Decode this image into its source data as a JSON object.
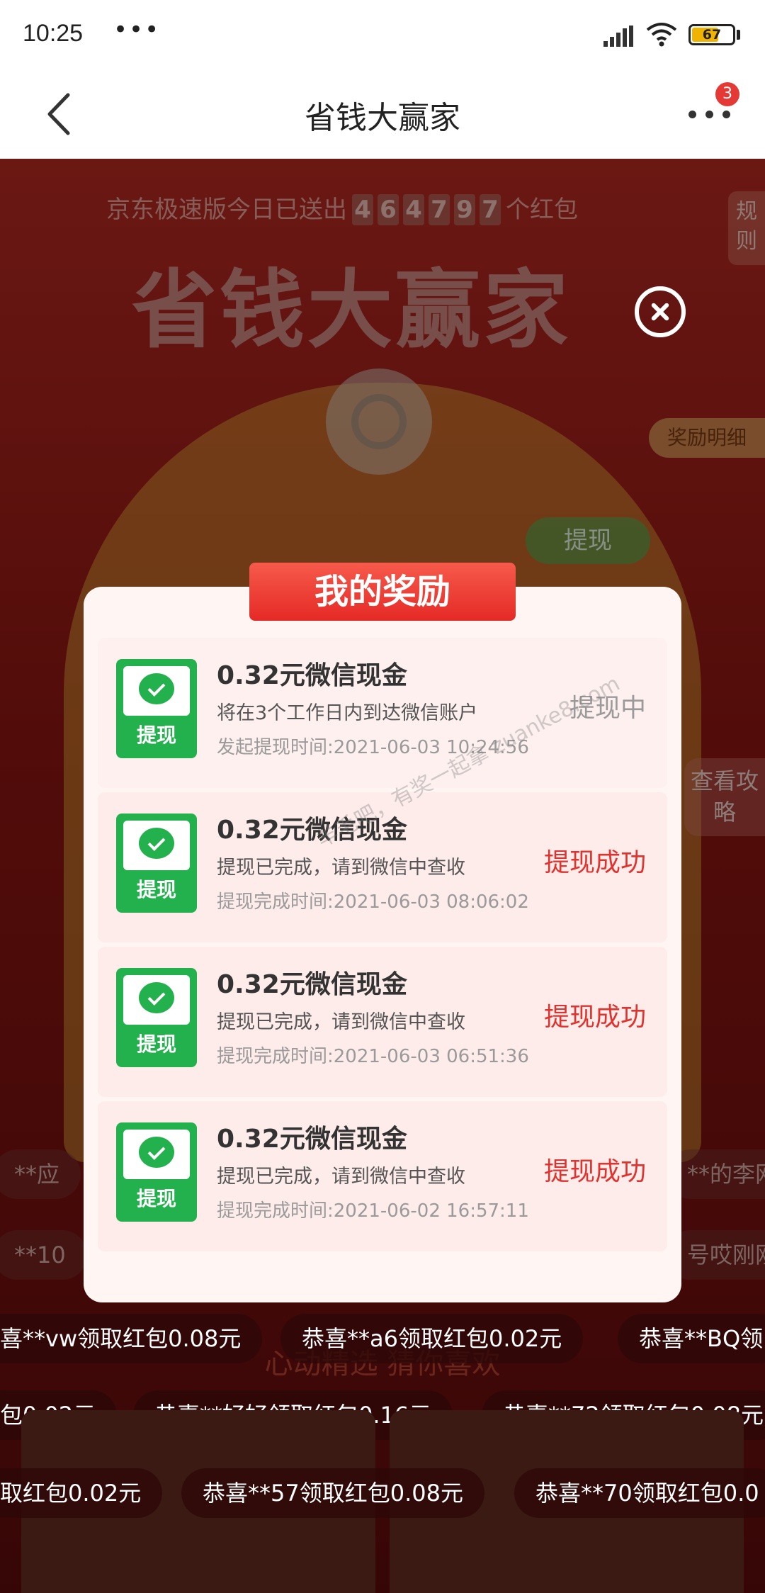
{
  "status_bar": {
    "time": "10:25",
    "dots": "•••",
    "battery": "67"
  },
  "nav": {
    "title": "省钱大赢家",
    "badge": "3"
  },
  "background": {
    "counter_prefix": "京东极速版今日已送出",
    "counter_digits": [
      "4",
      "6",
      "4",
      "7",
      "9",
      "7"
    ],
    "counter_suffix": "个红包",
    "rules_tab": "规则",
    "title": "省钱大赢家",
    "reward_detail_tag": "奖励明细",
    "withdraw_pill": "提现",
    "guide_tab": "查看攻略",
    "section_heading": "心动精选 猜你喜欢",
    "ticker_faded_1": [
      "**应",
      "**的李网"
    ],
    "ticker_faded_2": [
      "**10",
      "号哎刚刚"
    ]
  },
  "modal": {
    "title": "我的奖励",
    "icon_label": "提现",
    "items": [
      {
        "amount": "0.32元微信现金",
        "desc": "将在3个工作日内到达微信账户",
        "time": "发起提现时间:2021-06-03 10:24:56",
        "status": "提现中",
        "status_type": "pending"
      },
      {
        "amount": "0.32元微信现金",
        "desc": "提现已完成，请到微信中查收",
        "time": "提现完成时间:2021-06-03 08:06:02",
        "status": "提现成功",
        "status_type": "success"
      },
      {
        "amount": "0.32元微信现金",
        "desc": "提现已完成，请到微信中查收",
        "time": "提现完成时间:2021-06-03 06:51:36",
        "status": "提现成功",
        "status_type": "success"
      },
      {
        "amount": "0.32元微信现金",
        "desc": "提现已完成，请到微信中查收",
        "time": "提现完成时间:2021-06-02 16:57:11",
        "status": "提现成功",
        "status_type": "success"
      }
    ],
    "watermark": "羊毛吧，有奖一起拿 zuanke8.com"
  },
  "tickers": {
    "row1": [
      "喜**vw领取红包0.08元",
      "恭喜**a6领取红包0.02元",
      "恭喜**BQ领"
    ],
    "row2": [
      "包0.02元",
      "恭喜**好好领取红包0.16元",
      "恭喜**72领取红包0.08元"
    ],
    "row3": [
      "取红包0.02元",
      "恭喜**57领取红包0.08元",
      "恭喜**70领取红包0.0"
    ]
  }
}
